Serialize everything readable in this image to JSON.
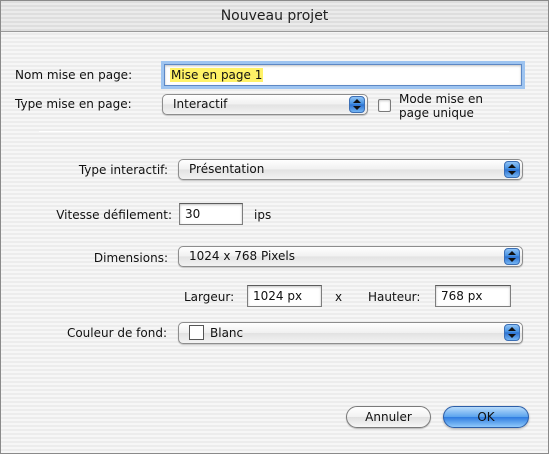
{
  "window": {
    "title": "Nouveau projet"
  },
  "form": {
    "layout_name": {
      "label": "Nom mise en page:",
      "value": "Mise en page 1"
    },
    "layout_type": {
      "label": "Type mise en page:",
      "value": "Interactif"
    },
    "single_layout": {
      "label_line1": "Mode mise en",
      "label_line2": "page unique",
      "checked": false
    },
    "interactive_type": {
      "label": "Type interactif:",
      "value": "Présentation"
    },
    "scroll_speed": {
      "label": "Vitesse défilement:",
      "value": "30",
      "unit": "ips"
    },
    "dimensions": {
      "label": "Dimensions:",
      "value": "1024 x 768 Pixels"
    },
    "width": {
      "label": "Largeur:",
      "value": "1024 px"
    },
    "times_sign": "x",
    "height": {
      "label": "Hauteur:",
      "value": "768 px"
    },
    "background_color": {
      "label": "Couleur de fond:",
      "value": "Blanc",
      "swatch": "#ffffff"
    }
  },
  "buttons": {
    "cancel": "Annuler",
    "ok": "OK"
  }
}
